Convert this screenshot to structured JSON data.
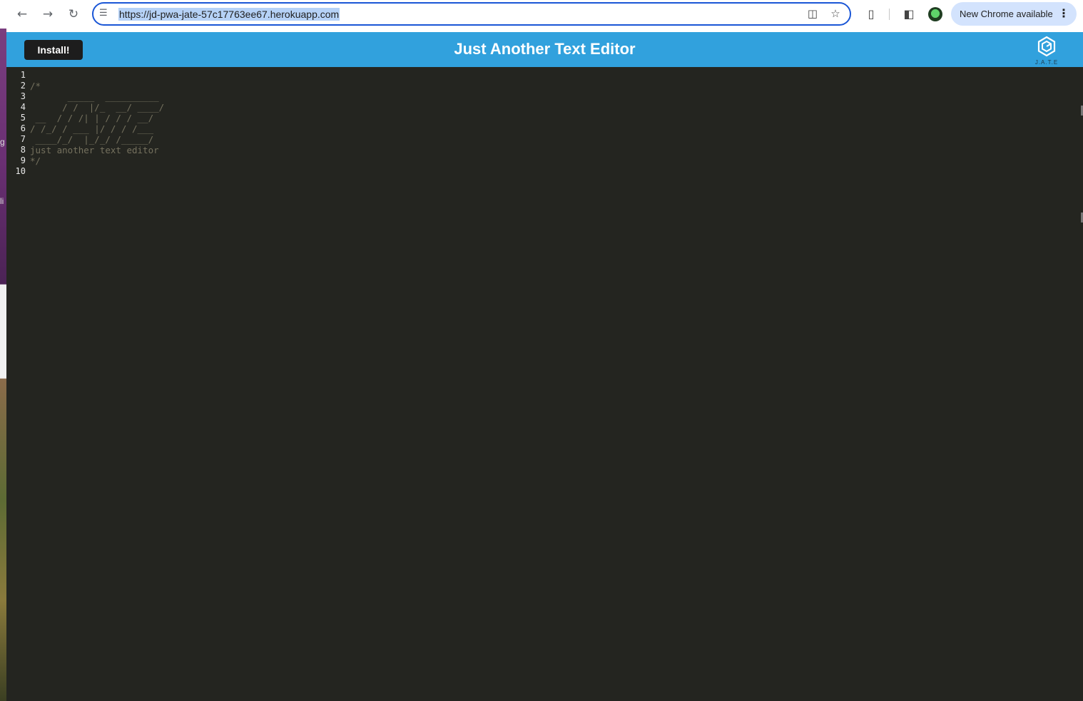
{
  "browser": {
    "url": "https://jd-pwa-jate-57c17763ee67.herokuapp.com",
    "update_chip_label": "New Chrome available",
    "icons": {
      "back": "arrow-left-icon",
      "forward": "arrow-right-icon",
      "reload": "reload-icon",
      "site_info": "tune-icon",
      "install_app": "install-app-icon",
      "bookmark": "star-icon",
      "extensions": "puzzle-icon",
      "side_panel": "side-panel-icon",
      "profile": "avatar",
      "menu": "kebab-icon"
    },
    "accent_color": "#1a56d6"
  },
  "desktop": {
    "fragments": [
      "g",
      "li"
    ]
  },
  "app": {
    "install_label": "Install!",
    "title": "Just Another Text Editor",
    "logo_text": "J.A.T.E",
    "header_color": "#31a1dd",
    "editor_bg": "#242520"
  },
  "editor": {
    "line_numbers": [
      "1",
      "2",
      "3",
      "4",
      "5",
      "6",
      "7",
      "8",
      "9",
      "10"
    ],
    "lines": [
      "",
      "/*",
      "       _____  __________",
      "      / /  |/_  __/ ____/",
      " __  / / /| | / / / __/",
      "/ /_/ / ___ |/ / / /___",
      " ____/_/  |_/_/ /_____/",
      "just another text editor",
      "*/",
      ""
    ]
  }
}
